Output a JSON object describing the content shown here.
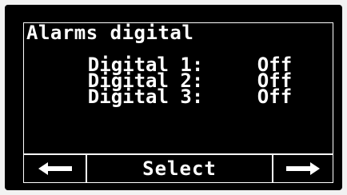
{
  "screen": {
    "title": "Alarms digital",
    "rows": [
      {
        "label": "Digital 1:",
        "value": "Off"
      },
      {
        "label": "Digital 2:",
        "value": "Off"
      },
      {
        "label": "Digital 3:",
        "value": "Off"
      }
    ]
  },
  "softkeys": {
    "left_icon": "arrow-left-icon",
    "select_label": "Select",
    "right_icon": "arrow-right-icon"
  },
  "colors": {
    "background": "#000000",
    "foreground": "#ffffff",
    "page": "#f2f2f2"
  }
}
